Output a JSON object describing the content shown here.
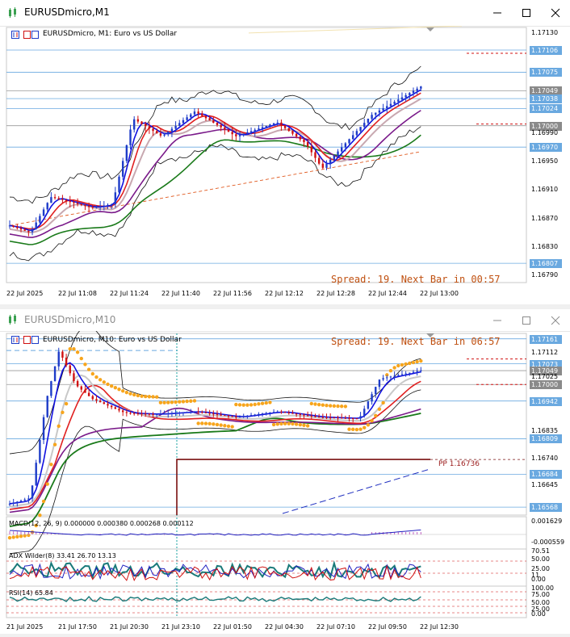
{
  "colors": {
    "bull": "#1e3cc8",
    "bear": "#d01010",
    "tag_blue": "#6aa9e0",
    "tag_dark": "#8a8a8a",
    "grid": "#d9d9d9",
    "ma_green": "#1a7a1a",
    "ma_purple": "#7a1a8a",
    "ma_red": "#e02020",
    "ma_blue": "#1010e0",
    "dots": "#f7a51c",
    "pp": "#7a1010"
  },
  "window1": {
    "title": "EURUSDmicro,M1",
    "chart_label": "EURUSDmicro, M1:  Euro vs US Dollar",
    "spread_text": "Spread: 19. Next Bar in 00:57",
    "price_tags": [
      {
        "value": "1.17106",
        "price": 1.17106,
        "style": "blue"
      },
      {
        "value": "1.17075",
        "price": 1.17075,
        "style": "blue"
      },
      {
        "value": "1.17049",
        "price": 1.17049,
        "style": "dark"
      },
      {
        "value": "1.17038",
        "price": 1.17038,
        "style": "blue"
      },
      {
        "value": "1.17024",
        "price": 1.17024,
        "style": "blue"
      },
      {
        "value": "1.17000",
        "price": 1.17,
        "style": "dark"
      },
      {
        "value": "1.16970",
        "price": 1.1697,
        "style": "blue"
      },
      {
        "value": "1.16807",
        "price": 1.16807,
        "style": "blue"
      }
    ],
    "price_labels": [
      "1.17130",
      "1.16990",
      "1.16950",
      "1.16910",
      "1.16870",
      "1.16830",
      "1.16790"
    ],
    "time_labels": [
      "22 Jul 2025",
      "22 Jul 11:08",
      "22 Jul 11:24",
      "22 Jul 11:40",
      "22 Jul 11:56",
      "22 Jul 12:12",
      "22 Jul 12:28",
      "22 Jul 12:44",
      "22 Jul 13:00"
    ]
  },
  "window2": {
    "title": "EURUSDmicro,M10",
    "chart_label": "EURUSDmicro, M10:  Euro vs US Dollar",
    "spread_text": "Spread: 19. Next Bar in 06:57",
    "price_tags": [
      {
        "value": "1.17161",
        "price": 1.17161,
        "style": "blue"
      },
      {
        "value": "1.17073",
        "price": 1.17073,
        "style": "blue"
      },
      {
        "value": "1.17049",
        "price": 1.17049,
        "style": "dark"
      },
      {
        "value": "1.17000",
        "price": 1.17,
        "style": "dark"
      },
      {
        "value": "1.16942",
        "price": 1.16942,
        "style": "blue"
      },
      {
        "value": "1.16809",
        "price": 1.16809,
        "style": "blue"
      },
      {
        "value": "1.16684",
        "price": 1.16684,
        "style": "blue"
      },
      {
        "value": "1.16568",
        "price": 1.16568,
        "style": "blue"
      }
    ],
    "price_labels": [
      "1.17112",
      "1.17025",
      "1.16835",
      "1.16740",
      "1.16645"
    ],
    "pp_label": "PP 1.16736",
    "pp_price": 1.16736,
    "macd": {
      "label": "MACD(12, 26, 9) 0.000000 0.000380 0.000268 0.000112",
      "scale_top": "0.001629",
      "scale_bottom": "-0.000559"
    },
    "adx": {
      "label": "ADX Wilder(8) 33.41 26.70 13.13",
      "levels": [
        "70.51",
        "50.00",
        "25.00",
        "11",
        "0.00"
      ]
    },
    "rsi": {
      "label": "RSI(14) 65.84",
      "levels": [
        "100.00",
        "75.00",
        "50.00",
        "25.00",
        "0.00"
      ]
    },
    "time_labels": [
      "21 Jul 2025",
      "21 Jul 17:50",
      "21 Jul 20:30",
      "21 Jul 23:10",
      "22 Jul 01:50",
      "22 Jul 04:30",
      "22 Jul 07:10",
      "22 Jul 09:50",
      "22 Jul 12:30"
    ]
  }
}
